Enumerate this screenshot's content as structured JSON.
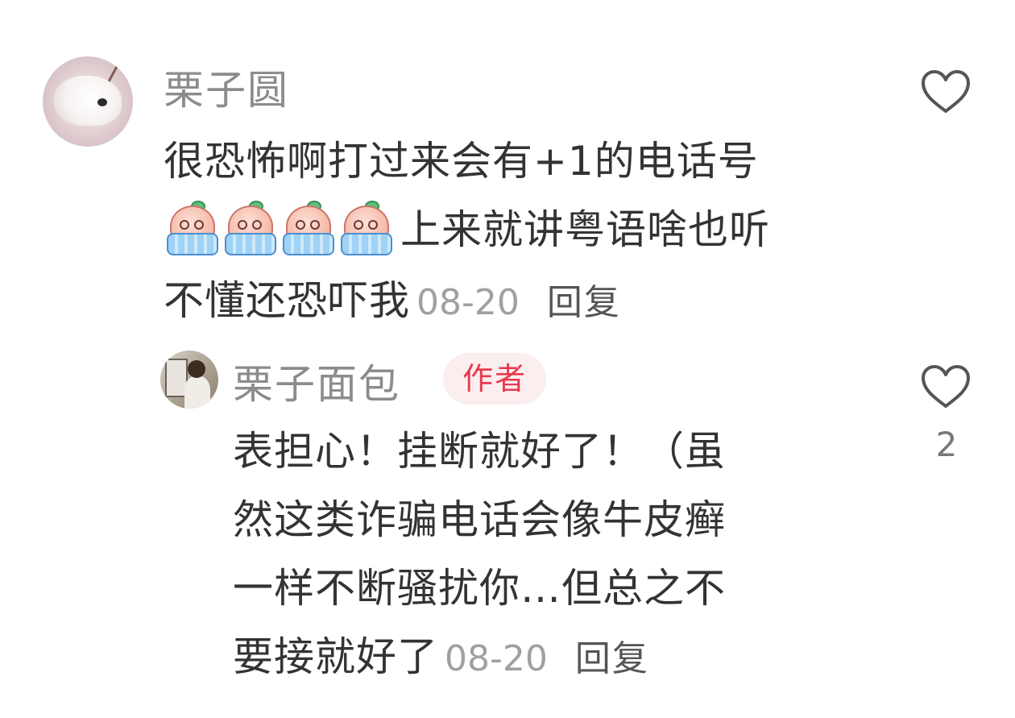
{
  "comments": {
    "main": {
      "username": "栗子圆",
      "text_line1": "很恐怖啊打过来会有+1的电话号",
      "emoji_name": "crying-peach-emoji",
      "emoji_count": 4,
      "text_line2": "上来就讲粤语啥也听",
      "text_line3": "不懂还恐吓我",
      "date": "08-20",
      "reply_label": "回复",
      "like_icon": "heart-outline-icon"
    },
    "reply": {
      "username": "栗子面包",
      "author_badge": "作者",
      "text_line1": "表担心！挂断就好了！（虽",
      "text_line2": "然这类诈骗电话会像牛皮癣",
      "text_line3": "一样不断骚扰你…但总之不",
      "text_line4": "要接就好了",
      "date": "08-20",
      "reply_label": "回复",
      "like_icon": "heart-outline-icon",
      "like_count": "2"
    }
  },
  "colors": {
    "username": "#8c8c8c",
    "body_text": "#333333",
    "meta_text": "#a0a0a0",
    "badge_text": "#e8394f",
    "badge_bg": "#fbeeee",
    "icon_stroke": "#555555"
  }
}
